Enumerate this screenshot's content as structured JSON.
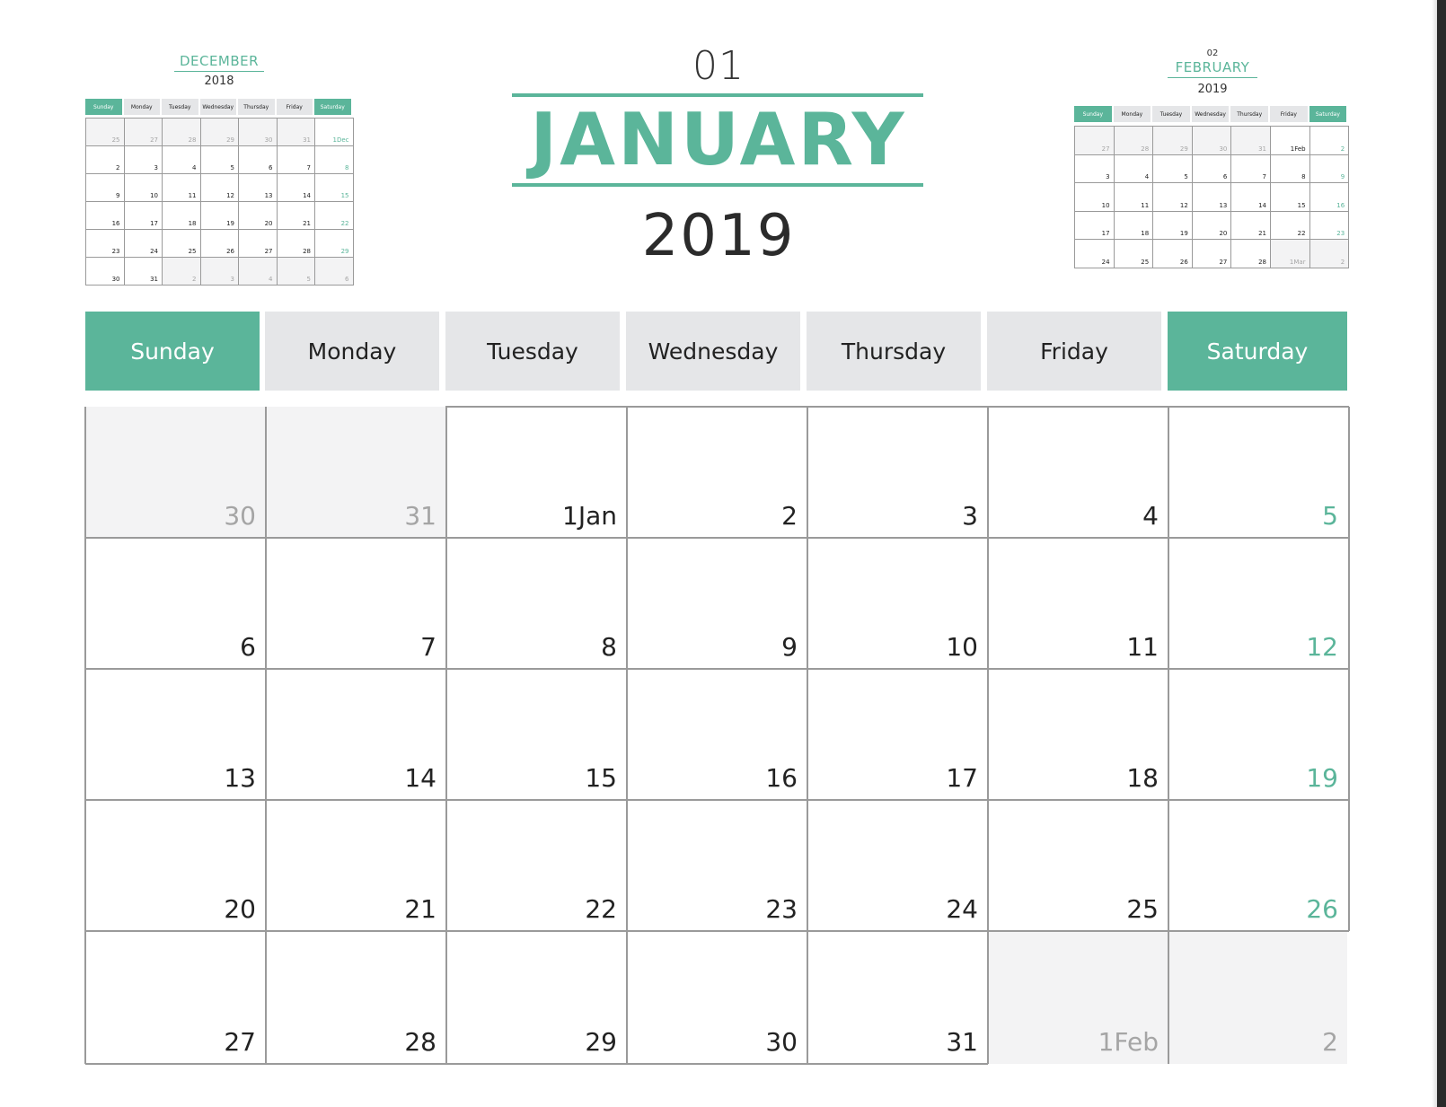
{
  "header": {
    "month_number": "01",
    "month_name": "JANUARY",
    "year": "2019"
  },
  "colors": {
    "accent": "#5bb59a",
    "weekday_header_bg": "#e5e6e8",
    "outside_day_bg": "#f3f3f4",
    "grid_line": "#9a9a9a"
  },
  "weekdays": [
    "Sunday",
    "Monday",
    "Tuesday",
    "Wednesday",
    "Thursday",
    "Friday",
    "Saturday"
  ],
  "main_weeks": [
    [
      {
        "d": "30",
        "out": true
      },
      {
        "d": "31",
        "out": true
      },
      {
        "d": "1Jan"
      },
      {
        "d": "2"
      },
      {
        "d": "3"
      },
      {
        "d": "4"
      },
      {
        "d": "5"
      }
    ],
    [
      {
        "d": "6"
      },
      {
        "d": "7"
      },
      {
        "d": "8"
      },
      {
        "d": "9"
      },
      {
        "d": "10"
      },
      {
        "d": "11"
      },
      {
        "d": "12"
      }
    ],
    [
      {
        "d": "13"
      },
      {
        "d": "14"
      },
      {
        "d": "15"
      },
      {
        "d": "16"
      },
      {
        "d": "17"
      },
      {
        "d": "18"
      },
      {
        "d": "19"
      }
    ],
    [
      {
        "d": "20"
      },
      {
        "d": "21"
      },
      {
        "d": "22"
      },
      {
        "d": "23"
      },
      {
        "d": "24"
      },
      {
        "d": "25"
      },
      {
        "d": "26"
      }
    ],
    [
      {
        "d": "27"
      },
      {
        "d": "28"
      },
      {
        "d": "29"
      },
      {
        "d": "30"
      },
      {
        "d": "31"
      },
      {
        "d": "1Feb",
        "out": true
      },
      {
        "d": "2",
        "out": true
      }
    ]
  ],
  "prev_month": {
    "month_name": "DECEMBER",
    "year": "2018",
    "weeks": [
      [
        {
          "d": "25",
          "out": true
        },
        {
          "d": "27",
          "out": true
        },
        {
          "d": "28",
          "out": true
        },
        {
          "d": "29",
          "out": true
        },
        {
          "d": "30",
          "out": true
        },
        {
          "d": "31",
          "out": true
        },
        {
          "d": "1Dec"
        }
      ],
      [
        {
          "d": "2"
        },
        {
          "d": "3"
        },
        {
          "d": "4"
        },
        {
          "d": "5"
        },
        {
          "d": "6"
        },
        {
          "d": "7"
        },
        {
          "d": "8"
        }
      ],
      [
        {
          "d": "9"
        },
        {
          "d": "10"
        },
        {
          "d": "11"
        },
        {
          "d": "12"
        },
        {
          "d": "13"
        },
        {
          "d": "14"
        },
        {
          "d": "15"
        }
      ],
      [
        {
          "d": "16"
        },
        {
          "d": "17"
        },
        {
          "d": "18"
        },
        {
          "d": "19"
        },
        {
          "d": "20"
        },
        {
          "d": "21"
        },
        {
          "d": "22"
        }
      ],
      [
        {
          "d": "23"
        },
        {
          "d": "24"
        },
        {
          "d": "25"
        },
        {
          "d": "26"
        },
        {
          "d": "27"
        },
        {
          "d": "28"
        },
        {
          "d": "29"
        }
      ],
      [
        {
          "d": "30"
        },
        {
          "d": "31"
        },
        {
          "d": "2",
          "out": true
        },
        {
          "d": "3",
          "out": true
        },
        {
          "d": "4",
          "out": true
        },
        {
          "d": "5",
          "out": true
        },
        {
          "d": "6",
          "out": true
        }
      ]
    ]
  },
  "next_month": {
    "month_number": "02",
    "month_name": "FEBRUARY",
    "year": "2019",
    "weeks": [
      [
        {
          "d": "27",
          "out": true
        },
        {
          "d": "28",
          "out": true
        },
        {
          "d": "29",
          "out": true
        },
        {
          "d": "30",
          "out": true
        },
        {
          "d": "31",
          "out": true
        },
        {
          "d": "1Feb"
        },
        {
          "d": "2"
        }
      ],
      [
        {
          "d": "3"
        },
        {
          "d": "4"
        },
        {
          "d": "5"
        },
        {
          "d": "6"
        },
        {
          "d": "7"
        },
        {
          "d": "8"
        },
        {
          "d": "9"
        }
      ],
      [
        {
          "d": "10"
        },
        {
          "d": "11"
        },
        {
          "d": "12"
        },
        {
          "d": "13"
        },
        {
          "d": "14"
        },
        {
          "d": "15"
        },
        {
          "d": "16"
        }
      ],
      [
        {
          "d": "17"
        },
        {
          "d": "18"
        },
        {
          "d": "19"
        },
        {
          "d": "20"
        },
        {
          "d": "21"
        },
        {
          "d": "22"
        },
        {
          "d": "23"
        }
      ],
      [
        {
          "d": "24"
        },
        {
          "d": "25"
        },
        {
          "d": "26"
        },
        {
          "d": "27"
        },
        {
          "d": "28"
        },
        {
          "d": "1Mar",
          "out": true
        },
        {
          "d": "2",
          "out": true
        }
      ]
    ]
  }
}
